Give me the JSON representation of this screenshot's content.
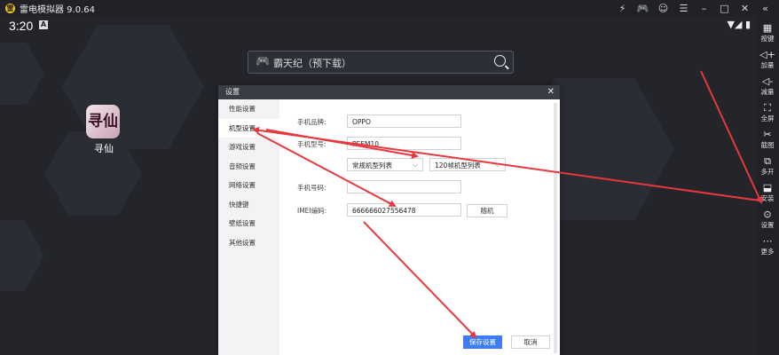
{
  "window": {
    "title": "雷电模拟器 9.0.64",
    "controls": [
      "⚡",
      "🎮",
      "☺",
      "☰",
      "–",
      "□",
      "✕",
      "«"
    ]
  },
  "status_bar": {
    "time": "3:20",
    "a_icon": "A",
    "right": "▼◢ ▮"
  },
  "search": {
    "pad_icon": "🎮",
    "text": "霸天纪（预下载）"
  },
  "desktop_app": {
    "icon_text": "寻仙",
    "label": "寻仙"
  },
  "sidebar": {
    "items": [
      {
        "icon": "▦",
        "label": "按键"
      },
      {
        "icon": "◁+",
        "label": "加量"
      },
      {
        "icon": "◁-",
        "label": "减量"
      },
      {
        "icon": "⛶",
        "label": "全屏"
      },
      {
        "icon": "✂",
        "label": "截图"
      },
      {
        "icon": "⧉",
        "label": "多开"
      },
      {
        "icon": "⬓",
        "label": "安装"
      },
      {
        "icon": "⊙",
        "label": "设置"
      },
      {
        "icon": "⋯",
        "label": "更多"
      }
    ]
  },
  "dialog": {
    "title": "设置",
    "close": "✕",
    "nav": [
      "性能设置",
      "机型设置",
      "游戏设置",
      "音频设置",
      "网络设置",
      "快捷键",
      "壁纸设置",
      "其他设置"
    ],
    "active_nav": "机型设置",
    "fields": {
      "brand_label": "手机品牌:",
      "brand_value": "OPPO",
      "model_label": "手机型号:",
      "model_value": "PEEM10",
      "model_select": "常规机型列表",
      "model_select2": "120帧机型列表",
      "phone_label": "手机号码:",
      "phone_value": "",
      "imei_label": "IMEI编码:",
      "imei_value": "666666027556478",
      "random_button": "随机"
    },
    "save_button": "保存设置",
    "cancel_button": "取消"
  },
  "colors": {
    "arrow": "#e8383d",
    "primary": "#3d7df2"
  }
}
